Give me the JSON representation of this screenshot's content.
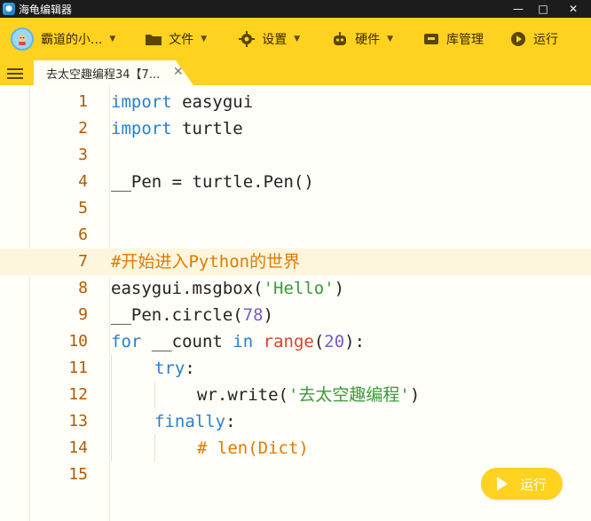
{
  "window": {
    "title": "海龟编辑器",
    "minimize": "—",
    "maximize": "□",
    "close": "✕"
  },
  "menubar": {
    "user": {
      "label": "霸道的小...",
      "icon": "user-avatar"
    },
    "file": {
      "label": "文件",
      "icon": "folder-icon"
    },
    "settings": {
      "label": "设置",
      "icon": "gear-icon"
    },
    "hardware": {
      "label": "硬件",
      "icon": "robot-icon"
    },
    "library": {
      "label": "库管理",
      "icon": "box-icon"
    },
    "run": {
      "label": "运行",
      "icon": "play-icon"
    }
  },
  "tab": {
    "title": "去太空趣编程34【7...",
    "close": "✕"
  },
  "editor": {
    "line_numbers": [
      "1",
      "2",
      "3",
      "4",
      "5",
      "6",
      "7",
      "8",
      "9",
      "10",
      "11",
      "12",
      "13",
      "14",
      "15"
    ],
    "active_line": 7,
    "lines": [
      {
        "t1": "import",
        "t2": " easygui"
      },
      {
        "t1": "import",
        "t2": " turtle"
      },
      {},
      {
        "t1": "__Pen = turtle.Pen()"
      },
      {},
      {},
      {
        "t1": "#开始进入Python的世界"
      },
      {
        "t1": "easygui.msgbox(",
        "t2": "'Hello'",
        "t3": ")"
      },
      {
        "t1": "__Pen.circle(",
        "t2": "78",
        "t3": ")"
      },
      {
        "t1": "for",
        "t2": " __count ",
        "t3": "in",
        "t4": " ",
        "t5": "range",
        "t6": "(",
        "t7": "20",
        "t8": "):"
      },
      {
        "t1": "try",
        "t2": ":"
      },
      {
        "t1": "wr.write(",
        "t2": "'去太空趣编程'",
        "t3": ")"
      },
      {
        "t1": "finally",
        "t2": ":"
      },
      {
        "t1": "# len(Dict)"
      },
      {}
    ]
  },
  "run_button": {
    "label": "运行"
  },
  "colors": {
    "accent": "#ffd21f",
    "keyword": "#2a7fd1",
    "string": "#3a9a3a",
    "number": "#7a5acb",
    "comment": "#e07a00",
    "builtin": "#d8442c",
    "line_number": "#b35a00"
  }
}
